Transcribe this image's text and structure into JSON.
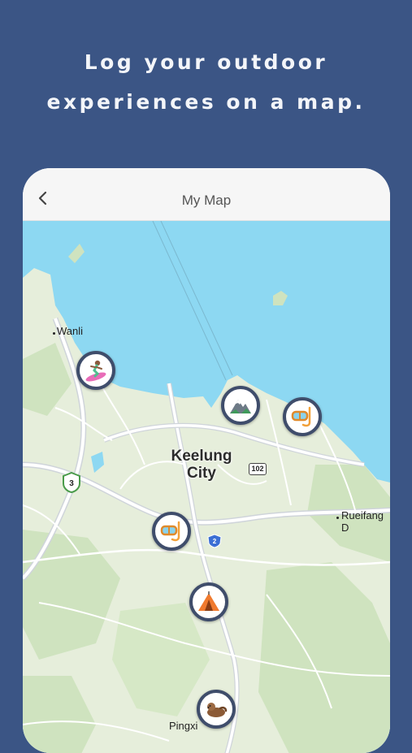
{
  "promo": {
    "headline_line1": "Log your outdoor",
    "headline_line2": "experiences on a map."
  },
  "navbar": {
    "title": "My Map",
    "back_icon": "chevron-left-icon"
  },
  "map": {
    "labels": {
      "wanli": "Wanli",
      "keelung_line1": "Keelung",
      "keelung_line2": "City",
      "ruifang": "Rueifang D",
      "pingxi": "Pingxi"
    },
    "road_shields": {
      "route_102": "102",
      "route_3": "3",
      "route_2": "2"
    },
    "markers": [
      {
        "icon": "surfer-icon",
        "activity": "surfing"
      },
      {
        "icon": "mountain-icon",
        "activity": "hiking"
      },
      {
        "icon": "snorkel-mask-icon",
        "activity": "snorkeling"
      },
      {
        "icon": "snorkel-mask-icon",
        "activity": "snorkeling"
      },
      {
        "icon": "tent-icon",
        "activity": "camping"
      },
      {
        "icon": "otter-icon",
        "activity": "wildlife"
      }
    ],
    "colors": {
      "water": "#8dd8f2",
      "land": "#e6eedb",
      "park": "#cfe3bf",
      "road": "#ffffff",
      "highway": "#cfd4da",
      "marker_border": "#3f4d6b"
    }
  },
  "colors": {
    "background": "#3b5585",
    "headline": "#f3f5f9"
  }
}
